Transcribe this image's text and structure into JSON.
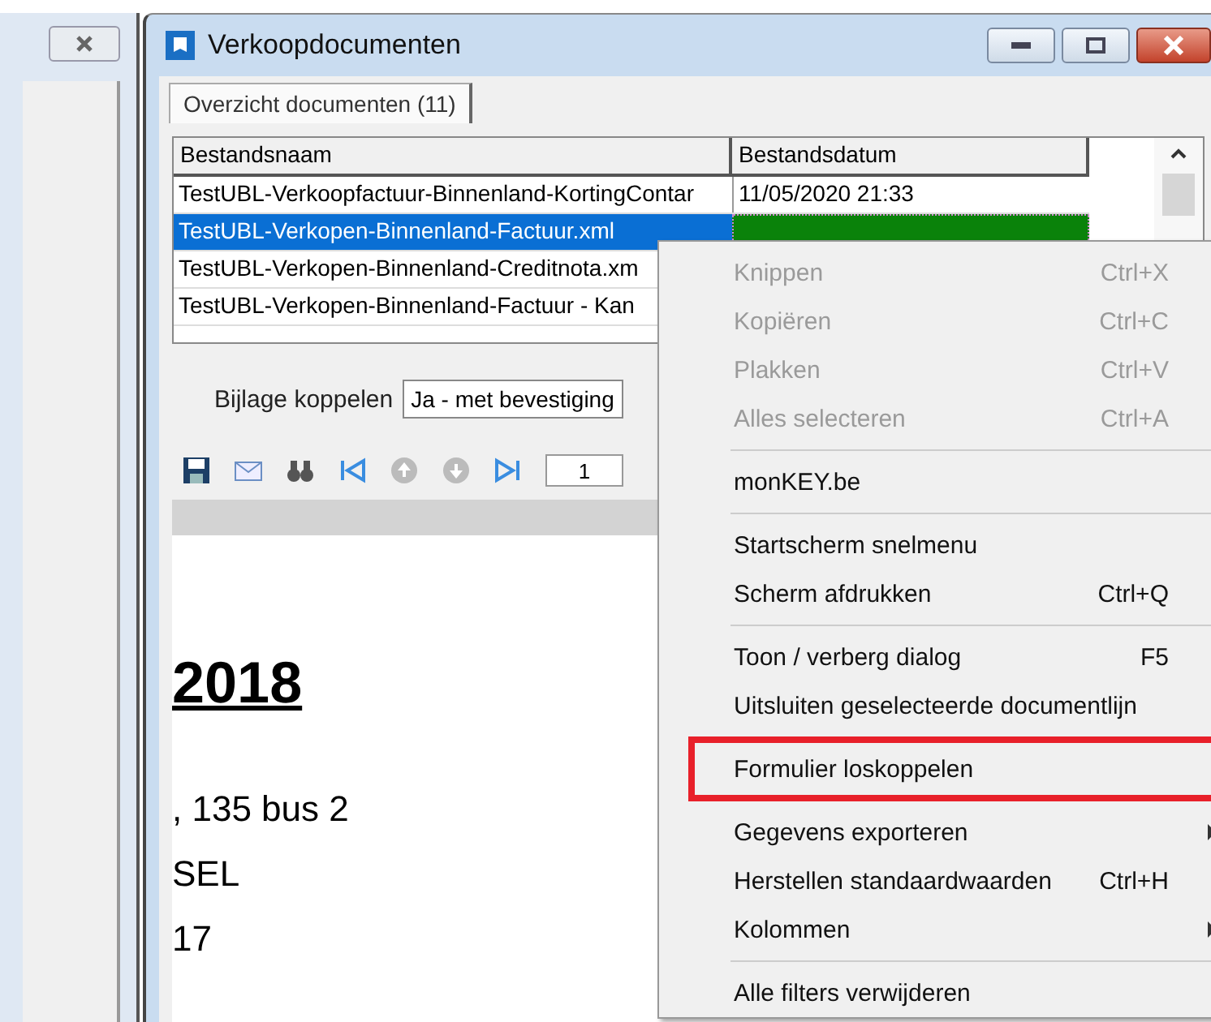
{
  "window": {
    "title": "Verkoopdocumenten"
  },
  "tabs": [
    {
      "label": "Overzicht documenten (11)",
      "selected": true
    }
  ],
  "table": {
    "columns": [
      "Bestandsnaam",
      "Bestandsdatum"
    ],
    "rows": [
      {
        "name": "TestUBL-Verkoopfactuur-Binnenland-KortingContar",
        "date": "11/05/2020 21:33",
        "selected": false
      },
      {
        "name": "TestUBL-Verkopen-Binnenland-Factuur.xml",
        "selected": true
      },
      {
        "name": "TestUBL-Verkopen-Binnenland-Creditnota.xm",
        "selected": false
      },
      {
        "name": "TestUBL-Verkopen-Binnenland-Factuur - Kan",
        "selected": false
      }
    ]
  },
  "attachment": {
    "label": "Bijlage koppelen",
    "value": "Ja - met bevestiging"
  },
  "toolbar": {
    "page": "1"
  },
  "preview": {
    "heading": "2018",
    "lines": [
      ", 135 bus 2",
      "SEL",
      "17"
    ]
  },
  "context_menu": [
    {
      "kind": "item",
      "label": "Knippen",
      "shortcut": "Ctrl+X",
      "disabled": true
    },
    {
      "kind": "item",
      "label": "Kopiëren",
      "shortcut": "Ctrl+C",
      "disabled": true
    },
    {
      "kind": "item",
      "label": "Plakken",
      "shortcut": "Ctrl+V",
      "disabled": true
    },
    {
      "kind": "item",
      "label": "Alles selecteren",
      "shortcut": "Ctrl+A",
      "disabled": true
    },
    {
      "kind": "separator"
    },
    {
      "kind": "item",
      "label": "monKEY.be",
      "disabled": false
    },
    {
      "kind": "separator"
    },
    {
      "kind": "item",
      "label": "Startscherm snelmenu",
      "disabled": false
    },
    {
      "kind": "item",
      "label": "Scherm afdrukken",
      "shortcut": "Ctrl+Q",
      "disabled": false
    },
    {
      "kind": "separator"
    },
    {
      "kind": "item",
      "label": "Toon / verberg dialog",
      "shortcut": "F5",
      "disabled": false
    },
    {
      "kind": "item",
      "label": "Uitsluiten geselecteerde documentlijn",
      "disabled": false
    },
    {
      "kind": "item",
      "label": "Formulier loskoppelen",
      "disabled": false,
      "highlighted": true
    },
    {
      "kind": "item",
      "label": "Gegevens exporteren",
      "disabled": false,
      "submenu": true
    },
    {
      "kind": "item",
      "label": "Herstellen standaardwaarden",
      "shortcut": "Ctrl+H",
      "disabled": false
    },
    {
      "kind": "item",
      "label": "Kolommen",
      "disabled": false,
      "submenu": true
    },
    {
      "kind": "separator"
    },
    {
      "kind": "item",
      "label": "Alle filters verwijderen",
      "disabled": false
    }
  ]
}
